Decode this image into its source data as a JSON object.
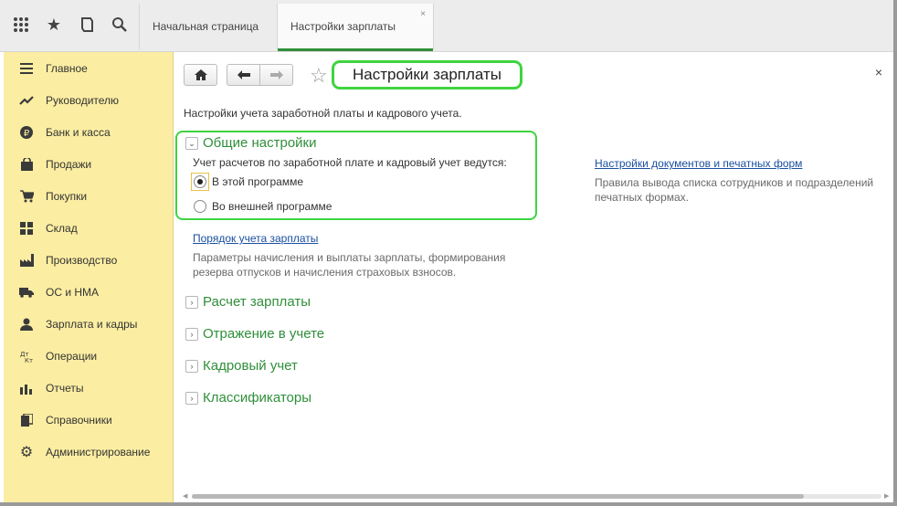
{
  "tabs": {
    "home_label": "Начальная страница",
    "active_label": "Настройки зарплаты",
    "close_glyph": "×"
  },
  "sidebar": {
    "items": [
      {
        "label": "Главное",
        "icon": "menu-lines-icon"
      },
      {
        "label": "Руководителю",
        "icon": "trend-chart-icon"
      },
      {
        "label": "Банк и касса",
        "icon": "ruble-coin-icon"
      },
      {
        "label": "Продажи",
        "icon": "shopping-bag-icon"
      },
      {
        "label": "Покупки",
        "icon": "shopping-cart-icon"
      },
      {
        "label": "Склад",
        "icon": "warehouse-grid-icon"
      },
      {
        "label": "Производство",
        "icon": "factory-icon"
      },
      {
        "label": "ОС и НМА",
        "icon": "truck-icon"
      },
      {
        "label": "Зарплата и кадры",
        "icon": "person-icon"
      },
      {
        "label": "Операции",
        "icon": "debit-credit-icon"
      },
      {
        "label": "Отчеты",
        "icon": "bar-chart-icon"
      },
      {
        "label": "Справочники",
        "icon": "books-icon"
      },
      {
        "label": "Администрирование",
        "icon": "gear-icon"
      }
    ]
  },
  "page": {
    "title": "Настройки зарплаты",
    "subtitle": "Настройки учета заработной платы и кадрового учета.",
    "close_glyph": "×"
  },
  "general": {
    "title": "Общие настройки",
    "question": "Учет расчетов по заработной плате и кадровый учет ведутся:",
    "options": [
      {
        "label": "В этой программе",
        "checked": true
      },
      {
        "label": "Во внешней программе",
        "checked": false
      }
    ]
  },
  "payroll_order": {
    "link": "Порядок учета зарплаты",
    "desc_line1": "Параметры начисления и выплаты зарплаты, формирования",
    "desc_line2": "резерва отпусков и начисления страховых взносов."
  },
  "docs_settings": {
    "link": "Настройки документов и печатных форм",
    "desc_line1": "Правила вывода списка сотрудников и подразделений",
    "desc_line2": "печатных формах."
  },
  "sections": [
    {
      "title": "Расчет зарплаты"
    },
    {
      "title": "Отражение в учете"
    },
    {
      "title": "Кадровый учет"
    },
    {
      "title": "Классификаторы"
    }
  ],
  "colors": {
    "accent_green": "#2f8f3a",
    "highlight_green": "#3fd43f",
    "sidebar_bg": "#fbeda2",
    "link_blue": "#1a4fa0"
  }
}
